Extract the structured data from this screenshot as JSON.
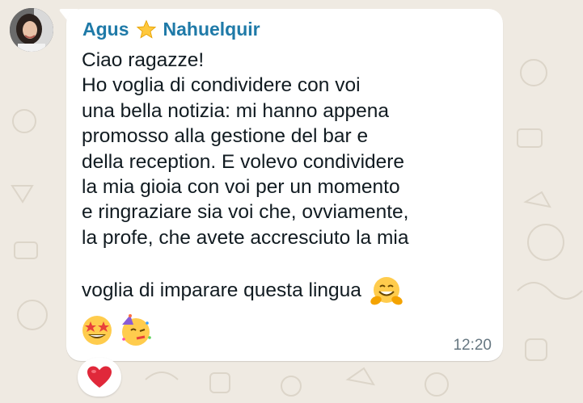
{
  "chat": {
    "sender_first": "Agus",
    "sender_last": "Nahuelquir",
    "message_text": "Ciao ragazze!\nHo voglia di condividere con voi\nuna bella notizia: mi hanno appena\npromosso alla gestione del bar e\ndella reception. E volevo condividere\nla mia gioia con voi per un momento\ne ringraziare sia voi che, ovviamente,\nla profe, che avete accresciuto la mia",
    "message_last_line": "voglia di imparare questa lingua",
    "inline_emoji": "hugging-face-icon",
    "emoji_row": [
      "star-struck-icon",
      "partying-face-icon"
    ],
    "time": "12:20",
    "reaction": "red-heart-icon"
  },
  "colors": {
    "background": "#efeae2",
    "bubble": "#ffffff",
    "sender_name": "#1f7aa8",
    "message_text": "#111b21",
    "timestamp": "#667781",
    "reaction_heart": "#e0283a"
  }
}
